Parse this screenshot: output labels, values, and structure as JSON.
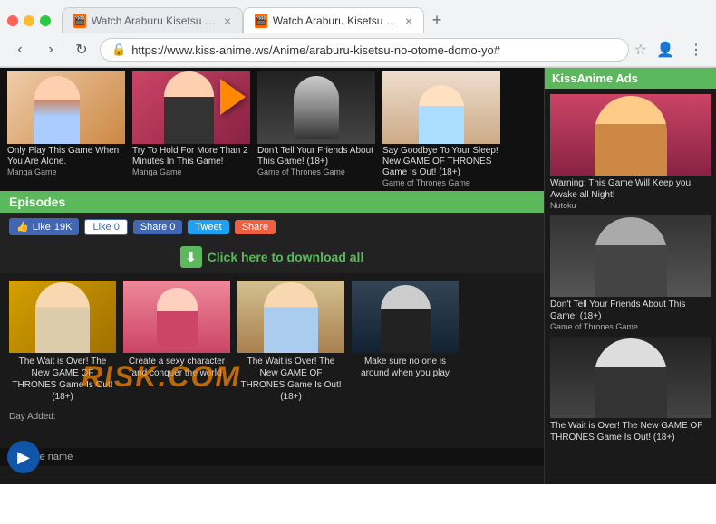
{
  "browser": {
    "tabs": [
      {
        "id": "tab1",
        "label": "Watch Araburu Kisetsu no Oto...",
        "active": false,
        "favicon": "🎬"
      },
      {
        "id": "tab2",
        "label": "Watch Araburu Kisetsu no Oto...",
        "active": true,
        "favicon": "🎬"
      }
    ],
    "new_tab_label": "+",
    "nav": {
      "back": "‹",
      "forward": "›",
      "refresh": "↻",
      "address": "https://www.kiss-anime.ws/Anime/araburu-kisetsu-no-otome-domo-yo#",
      "star": "☆",
      "account": "👤",
      "menu": "⋮"
    }
  },
  "page": {
    "kiss_anime_ads_label": "KissAnime Ads",
    "episodes_label": "Episodes",
    "download_label": "Click here to download all",
    "like_count": "19K",
    "social": {
      "like": "Like",
      "fb_like": "Like 0",
      "fb_share": "Share 0",
      "tweet": "Tweet",
      "share": "Share"
    },
    "top_ads": [
      {
        "title": "Only Play This Game When You Are Alone.",
        "source": "Manga Game"
      },
      {
        "title": "Try To Hold For More Than 2 Minutes In This Game!",
        "source": "Manga Game"
      },
      {
        "title": "Don't Tell Your Friends About This Game! (18+)",
        "source": "Game of Thrones Game"
      },
      {
        "title": "Say Goodbye To Your Sleep! New GAME OF THRONES Game Is Out! (18+)",
        "source": "Game of Thrones Game"
      }
    ],
    "episodes": [
      {
        "title": "The Wait is Over! The New GAME OF THRONES Game Is Out! (18+)"
      },
      {
        "title": "Create a sexy character and conquer the world"
      },
      {
        "title": "The Wait is Over! The New GAME OF THRONES Game Is Out! (18+)"
      },
      {
        "title": "Make sure no one is around when you play"
      }
    ],
    "sidebar": {
      "header": "KissAnime Ads",
      "ads": [
        {
          "title": "Warning: This Game Will Keep you Awake all Night!",
          "source": "Nutoku"
        },
        {
          "title": "Don't Tell Your Friends About This Game! (18+)",
          "source": "Game of Thrones Game"
        },
        {
          "title": "The Wait is Over! The New GAME OF THRONES Game Is Out! (18+)",
          "source": ""
        }
      ]
    },
    "watermark": "RISK.COM",
    "bottom": {
      "episode_label": "Episode name",
      "day_added": "Day Added:"
    }
  }
}
